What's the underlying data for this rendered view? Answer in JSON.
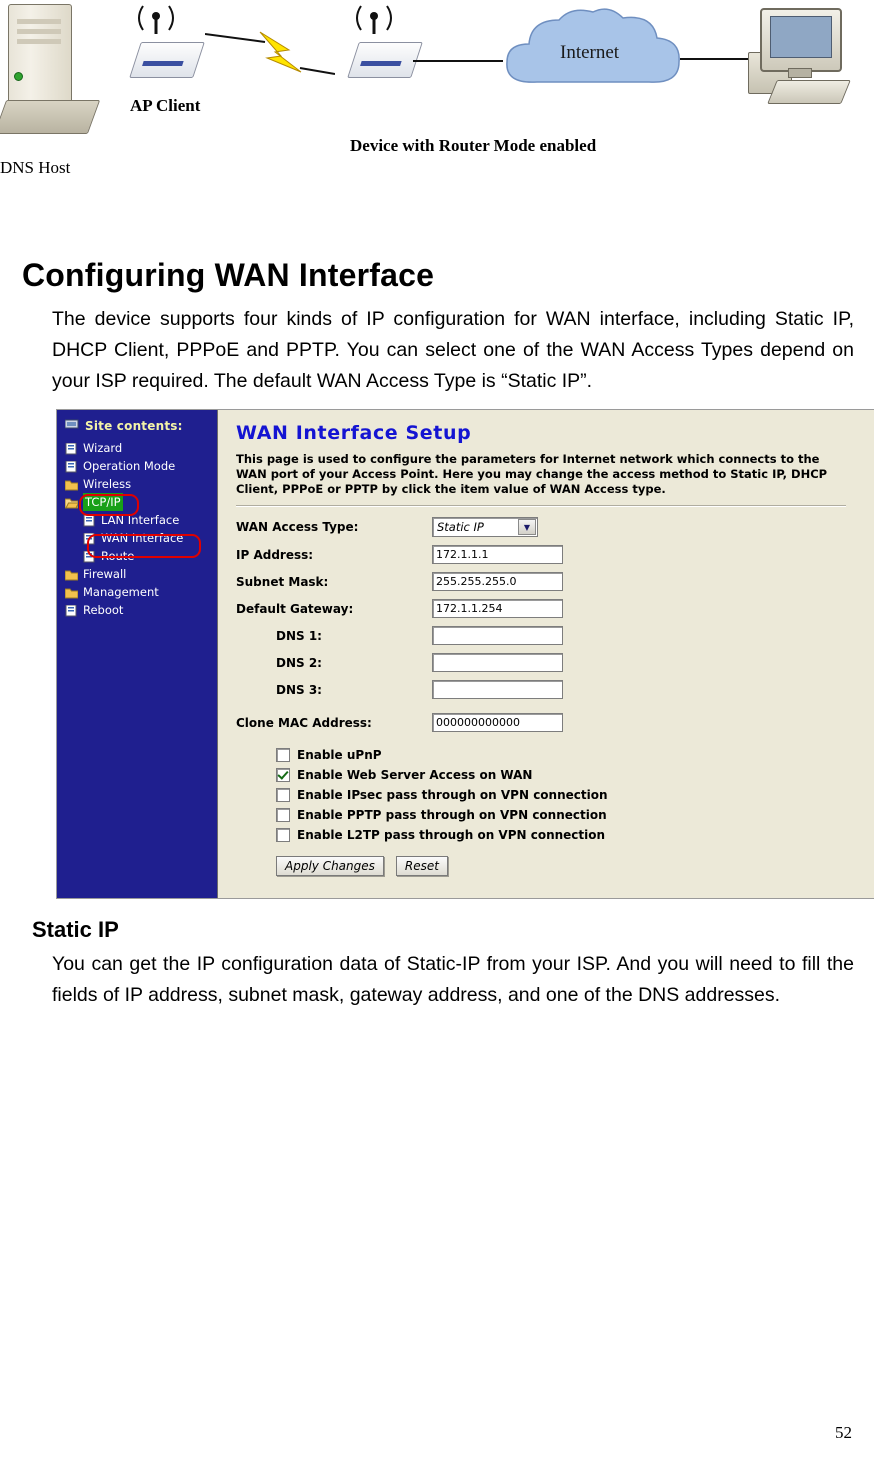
{
  "diagram": {
    "dns_host_label": "DNS Host",
    "ap_client_label": "AP Client",
    "router_label": "Device with Router Mode enabled",
    "internet_label": "Internet"
  },
  "section": {
    "title": "Configuring WAN Interface",
    "paragraph": "The device supports four kinds of IP configuration for WAN interface, including Static IP, DHCP Client, PPPoE and PPTP. You can select one of the WAN Access Types depend on your ISP required. The default WAN Access Type is “Static IP”.",
    "sub_title": "Static IP",
    "sub_paragraph": "You can get the IP configuration data of Static-IP from your ISP. And you will need to fill the fields of IP address, subnet mask, gateway address, and one of the DNS addresses."
  },
  "screenshot": {
    "sidebar": {
      "header": "Site contents:",
      "items": [
        {
          "label": "Wizard",
          "level": 1,
          "icon": "page-icon",
          "selected": false
        },
        {
          "label": "Operation Mode",
          "level": 1,
          "icon": "page-icon",
          "selected": false
        },
        {
          "label": "Wireless",
          "level": 1,
          "icon": "folder-icon",
          "selected": false
        },
        {
          "label": "TCP/IP",
          "level": 1,
          "icon": "folder-open-icon",
          "selected": true
        },
        {
          "label": "LAN Interface",
          "level": 2,
          "icon": "page-icon",
          "selected": false
        },
        {
          "label": "WAN Interface",
          "level": 2,
          "icon": "page-icon",
          "selected": false
        },
        {
          "label": "Route",
          "level": 2,
          "icon": "page-icon",
          "selected": false
        },
        {
          "label": "Firewall",
          "level": 1,
          "icon": "folder-icon",
          "selected": false
        },
        {
          "label": "Management",
          "level": 1,
          "icon": "folder-icon",
          "selected": false
        },
        {
          "label": "Reboot",
          "level": 1,
          "icon": "page-icon",
          "selected": false
        }
      ]
    },
    "main": {
      "title": "WAN Interface Setup",
      "description": "This page is used to configure the parameters for Internet network which connects to the WAN port of your Access Point. Here you may change the access method to Static IP, DHCP Client, PPPoE or PPTP by click the item value of WAN Access type.",
      "fields": [
        {
          "label": "WAN Access Type:",
          "value": "Static IP",
          "type": "select",
          "indent": false
        },
        {
          "label": "IP Address:",
          "value": "172.1.1.1",
          "type": "text",
          "indent": false
        },
        {
          "label": "Subnet Mask:",
          "value": "255.255.255.0",
          "type": "text",
          "indent": false
        },
        {
          "label": "Default Gateway:",
          "value": "172.1.1.254",
          "type": "text",
          "indent": false
        },
        {
          "label": "DNS 1:",
          "value": "",
          "type": "text",
          "indent": true
        },
        {
          "label": "DNS 2:",
          "value": "",
          "type": "text",
          "indent": true
        },
        {
          "label": "DNS 3:",
          "value": "",
          "type": "text",
          "indent": true
        },
        {
          "label": "Clone MAC Address:",
          "value": "000000000000",
          "type": "text",
          "indent": false
        }
      ],
      "checkboxes": [
        {
          "label": "Enable uPnP",
          "checked": false
        },
        {
          "label": "Enable Web Server Access on WAN",
          "checked": true
        },
        {
          "label": "Enable IPsec pass through on VPN connection",
          "checked": false
        },
        {
          "label": "Enable PPTP pass through on VPN connection",
          "checked": false
        },
        {
          "label": "Enable L2TP pass through on VPN connection",
          "checked": false
        }
      ],
      "buttons": {
        "apply": "Apply Changes",
        "reset": "Reset"
      }
    }
  },
  "footer": {
    "page_number": "52"
  },
  "colors": {
    "sidebar_bg": "#1f1f8f",
    "panel_bg": "#ece9d8",
    "title_blue": "#1414d2",
    "highlight_green": "#18a018",
    "callout_red": "#e00000"
  }
}
